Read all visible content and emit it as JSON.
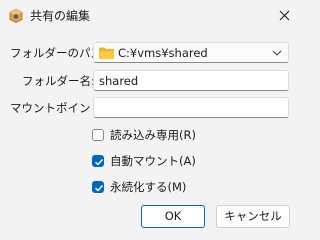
{
  "window": {
    "title": "共有の編集",
    "app_icon": "virtualbox-cube-icon",
    "close_icon": "close-icon"
  },
  "form": {
    "folder_path_label": "フォルダーのパス:",
    "folder_path_value": "C:¥vms¥shared",
    "folder_name_label": "フォルダー名:",
    "folder_name_value": "shared",
    "mount_point_label": "マウントポイント:",
    "mount_point_value": ""
  },
  "options": {
    "read_only": {
      "label": "読み込み専用(R)",
      "checked": false
    },
    "auto_mount": {
      "label": "自動マウント(A)",
      "checked": true
    },
    "permanent": {
      "label": "永続化する(M)",
      "checked": true
    }
  },
  "buttons": {
    "ok": "OK",
    "cancel": "キャンセル"
  },
  "colors": {
    "accent": "#0067c0",
    "background": "#f3f3f3"
  }
}
